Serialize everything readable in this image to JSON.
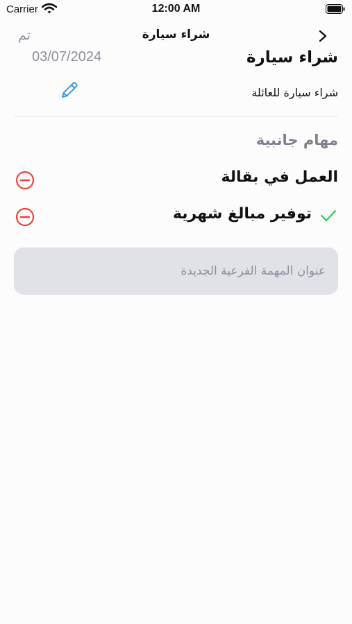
{
  "status_bar": {
    "carrier": "Carrier",
    "time": "12:00 AM"
  },
  "nav": {
    "done_label": "تم",
    "title": "شراء سيارة",
    "back_icon": "chevron-right-icon"
  },
  "task": {
    "title": "شراء سيارة",
    "date": "03/07/2024",
    "description": "شراء سيارة للعائلة",
    "edit_icon": "pencil-icon"
  },
  "subtasks": {
    "heading": "مهام جانبية",
    "items": [
      {
        "label": "العمل في بقالة",
        "completed": false
      },
      {
        "label": "توفير مبالغ شهرية",
        "completed": true
      }
    ],
    "new_placeholder": "عنوان المهمة الفرعية الجديدة"
  },
  "colors": {
    "accent": "#3a9ad9",
    "remove": "#e8453c",
    "check": "#34c759",
    "muted": "#8d8f9d",
    "field_bg": "#e1e2e7"
  }
}
